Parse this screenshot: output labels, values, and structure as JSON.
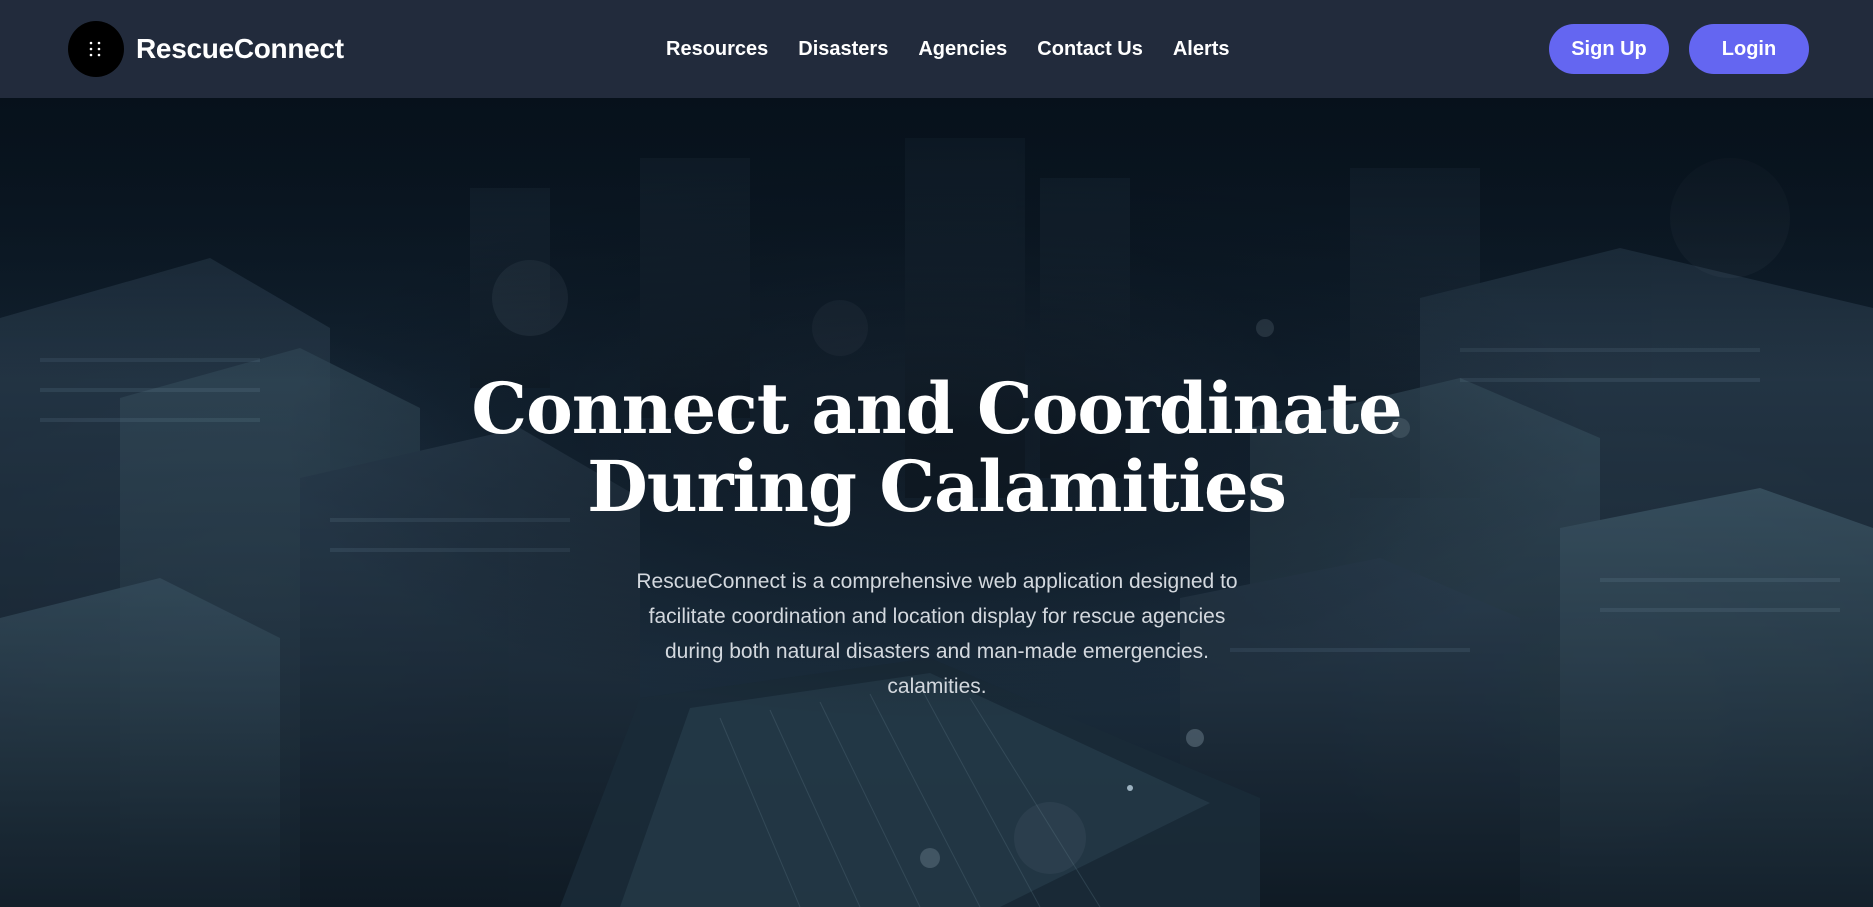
{
  "brand": {
    "name": "RescueConnect",
    "logo_icon": "grid-dots-icon"
  },
  "nav": {
    "items": [
      {
        "label": "Resources"
      },
      {
        "label": "Disasters"
      },
      {
        "label": "Agencies"
      },
      {
        "label": "Contact Us"
      },
      {
        "label": "Alerts"
      }
    ]
  },
  "auth": {
    "signup_label": "Sign Up",
    "login_label": "Login"
  },
  "hero": {
    "title_line1": "Connect and Coordinate",
    "title_line2": "During Calamities",
    "description": "RescueConnect is a comprehensive web application designed to facilitate coordination and location display for rescue agencies during both natural disasters and man-made emergencies. calamities.",
    "background": "aerial-city-night-image"
  },
  "colors": {
    "navbar_bg": "#222b3c",
    "accent": "#6466f1",
    "text": "#ffffff"
  }
}
